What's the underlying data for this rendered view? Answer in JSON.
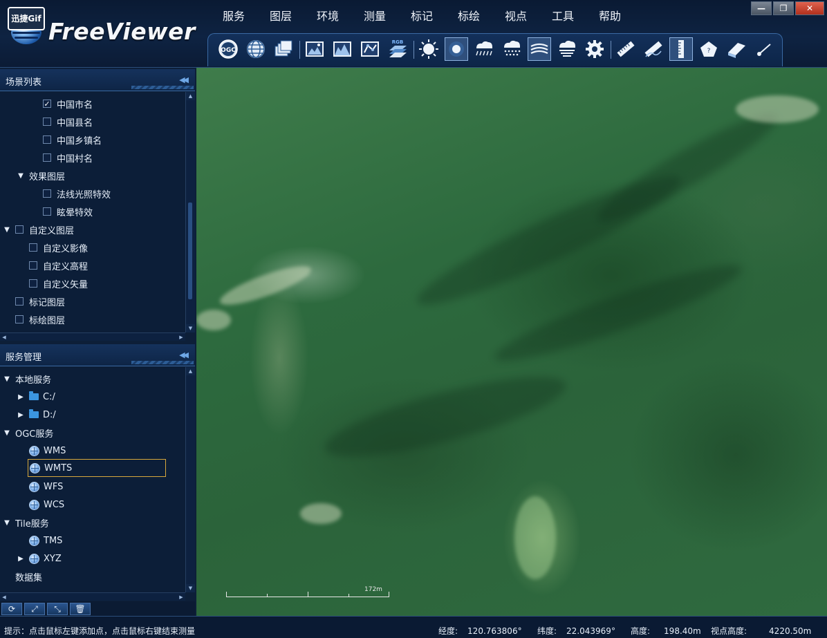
{
  "app": {
    "badge": "迅捷Gif",
    "title": "FreeViewer"
  },
  "menu": [
    "服务",
    "图层",
    "环境",
    "测量",
    "标记",
    "标绘",
    "视点",
    "工具",
    "帮助"
  ],
  "window_controls": [
    "minimize",
    "restore",
    "close"
  ],
  "toolbar_icons": [
    {
      "name": "ogc-icon",
      "label": "OGC"
    },
    {
      "name": "globe-icon"
    },
    {
      "name": "layers-icon"
    },
    {
      "name": "image-icon"
    },
    {
      "name": "terrain-icon"
    },
    {
      "name": "vector-icon"
    },
    {
      "name": "rgb-icon",
      "label": "RGB"
    },
    {
      "name": "sun-icon"
    },
    {
      "name": "sphere-icon"
    },
    {
      "name": "rain-icon"
    },
    {
      "name": "snow-icon"
    },
    {
      "name": "wind-icon"
    },
    {
      "name": "fog-icon"
    },
    {
      "name": "settings-icon"
    },
    {
      "name": "ruler-icon"
    },
    {
      "name": "path-measure-icon"
    },
    {
      "name": "height-measure-icon"
    },
    {
      "name": "area-measure-icon"
    },
    {
      "name": "plane-measure-icon"
    },
    {
      "name": "pen-icon"
    }
  ],
  "scene_panel": {
    "title": "场景列表",
    "items": [
      {
        "label": "中国市名",
        "checked": true
      },
      {
        "label": "中国县名",
        "checked": false
      },
      {
        "label": "中国乡镇名",
        "checked": false
      },
      {
        "label": "中国村名",
        "checked": false
      },
      {
        "label": "效果图层"
      },
      {
        "label": "法线光照特效",
        "checked": false
      },
      {
        "label": "眩晕特效",
        "checked": false
      },
      {
        "label": "自定义图层",
        "checked": false
      },
      {
        "label": "自定义影像",
        "checked": false
      },
      {
        "label": "自定义高程",
        "checked": false
      },
      {
        "label": "自定义矢量",
        "checked": false
      },
      {
        "label": "标记图层",
        "checked": false
      },
      {
        "label": "标绘图层",
        "checked": false
      }
    ]
  },
  "service_panel": {
    "title": "服务管理",
    "items": [
      {
        "label": "本地服务"
      },
      {
        "label": "C:/"
      },
      {
        "label": "D:/"
      },
      {
        "label": "OGC服务"
      },
      {
        "label": "WMS"
      },
      {
        "label": "WMTS",
        "selected": true
      },
      {
        "label": "WFS"
      },
      {
        "label": "WCS"
      },
      {
        "label": "Tile服务"
      },
      {
        "label": "TMS"
      },
      {
        "label": "XYZ"
      },
      {
        "label": "数据集"
      }
    ]
  },
  "bottom_tools": [
    "refresh-icon",
    "expand-icon",
    "collapse-icon",
    "delete-icon"
  ],
  "map": {
    "scale_label": "172m"
  },
  "status": {
    "hint": "提示：点击鼠标左键添加点，点击鼠标右键结束测量",
    "lon_label": "经度:",
    "lon_value": "120.763806°",
    "lat_label": "纬度:",
    "lat_value": "22.043969°",
    "alt_label": "高度:",
    "alt_value": "198.40m",
    "view_alt_label": "视点高度:",
    "view_alt_value": "4220.50m"
  },
  "colors": {
    "header_bg": "#0e2342",
    "panel_bg": "#0c1e38",
    "accent": "#3b95e0",
    "selection": "#d9a93c",
    "map_green": "#2d6a3e"
  }
}
